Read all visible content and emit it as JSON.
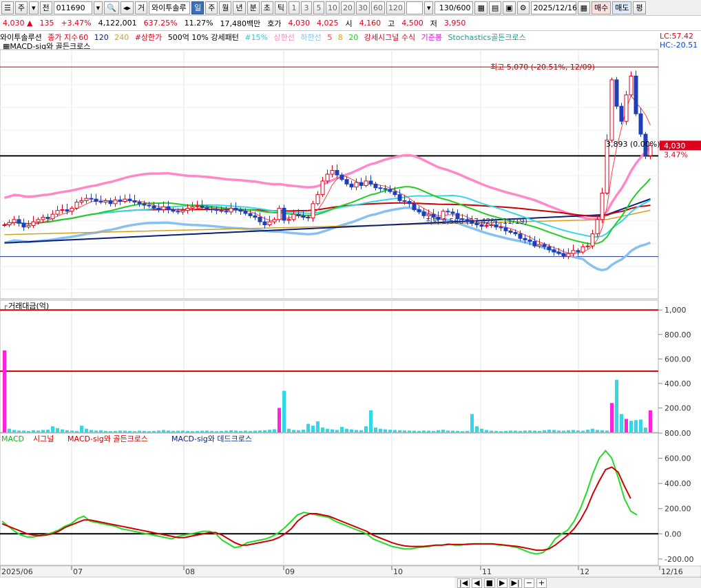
{
  "toolbar": {
    "market_label": "주",
    "jeon_label": "전",
    "code": "011690",
    "geo_label": "거",
    "stock_name": "와이투솔루",
    "periods": [
      "일",
      "주",
      "월",
      "년",
      "분",
      "초",
      "틱"
    ],
    "selected_period": "일",
    "numbers": [
      "1",
      "3",
      "5",
      "10",
      "20",
      "30",
      "60",
      "120"
    ],
    "count": "130/600",
    "date": "2025/12/16",
    "buy_label": "매수",
    "sell_label": "매도",
    "flat_label": "평"
  },
  "quote": {
    "price": "4,030",
    "change": "135",
    "change_pct": "+3.47%",
    "volume": "4,122,001",
    "vol_ratio": "637.25%",
    "turnover": "11.27%",
    "amount": "17,480백만",
    "hoga_label": "호가",
    "hoga1": "4,030",
    "hoga2": "4,025",
    "open_label": "시",
    "open": "4,160",
    "high_label": "고",
    "high": "4,500",
    "low_label": "저",
    "low": "3,950"
  },
  "legend": {
    "name": "와이투솔루션",
    "ma_label": "종가 지수",
    "ma60": "60",
    "ma120": "120",
    "ma240": "240",
    "upper_limit": "#상한가",
    "pattern": "500억 10% 강세패턴",
    "pct15": "#15%",
    "upper_line": "상한선",
    "lower_line": "하한선",
    "ma5": "5",
    "ma8": "8",
    "ma20": "20",
    "strong_signal": "강세시그널 수식",
    "base_line": "기준봉",
    "stoch": "Stochastics골든크로스",
    "macd_gold": "MACD-sig와 골든크로스",
    "lc": "LC:57.42",
    "hc": "HC:-20.51"
  },
  "price_panel": {
    "max_label": "최고 5,070 (-20.51%, 12/09)",
    "min_label": "최저 2,560 (57.42%, 11/19)",
    "line_label": "3,893 (0.00%)",
    "current_price": "4,030",
    "current_pct": "3.47%"
  },
  "volume_panel": {
    "title": "거래대금(억)",
    "ticks": [
      "1,000",
      "800.00",
      "600.00",
      "400.00",
      "200.00"
    ]
  },
  "macd_panel": {
    "title_macd": "MACD",
    "title_signal": "시그널",
    "title_gold": "MACD-sig와 골든크로스",
    "title_dead": "MACD-sig와 데드크로스",
    "ticks": [
      "800.00",
      "600.00",
      "400.00",
      "200.00",
      "0.00",
      "-200.00"
    ]
  },
  "x_axis": {
    "labels": [
      "2025/06",
      "07",
      "08",
      "09",
      "10",
      "11",
      "12",
      "12/16"
    ]
  },
  "colors": {
    "up": "#e0001b",
    "down": "#1f3fb8",
    "ma5": "#ff4040",
    "ma20": "#22cc22",
    "envelope": "#ff88c8",
    "bb_lower": "#88c0f0",
    "ma60": "#cc0000",
    "ma120": "#0a1f7a",
    "ma240": "#d4a020",
    "cyan": "#33d8e8",
    "magenta": "#ff22dd",
    "macd": "#22dd22",
    "signal": "#cc0000"
  },
  "chart_data": [
    {
      "type": "candlestick",
      "title": "와이투솔루션",
      "y_range": [
        2000,
        5300
      ],
      "y_labels": [],
      "notable": {
        "high": 5070,
        "high_date": "12/09",
        "low": 2560,
        "low_date": "11/19",
        "horizontal_line": 3893,
        "last": 4030
      },
      "closes": [
        2980,
        3010,
        3050,
        3000,
        2950,
        2970,
        3020,
        3050,
        3080,
        3060,
        3120,
        3170,
        3180,
        3160,
        3200,
        3280,
        3300,
        3330,
        3320,
        3290,
        3280,
        3300,
        3260,
        3310,
        3290,
        3320,
        3300,
        3280,
        3260,
        3240,
        3230,
        3200,
        3180,
        3220,
        3180,
        3160,
        3150,
        3170,
        3200,
        3220,
        3230,
        3210,
        3190,
        3180,
        3170,
        3160,
        3150,
        3200,
        3180,
        3160,
        3130,
        3100,
        3080,
        3020,
        2980,
        3020,
        3050,
        3200,
        3040,
        3050,
        3120,
        3100,
        3080,
        3070,
        3260,
        3380,
        3560,
        3650,
        3700,
        3640,
        3580,
        3520,
        3480,
        3540,
        3500,
        3560,
        3520,
        3470,
        3460,
        3450,
        3420,
        3380,
        3300,
        3290,
        3260,
        3180,
        3150,
        3100,
        3120,
        3080,
        3050,
        3160,
        3150,
        3130,
        3060,
        3050,
        3020,
        3000,
        2980,
        2960,
        2970,
        2980,
        2950,
        2940,
        2900,
        2880,
        2860,
        2800,
        2780,
        2760,
        2700,
        2720,
        2690,
        2650,
        2620,
        2600,
        2560,
        2600,
        2640,
        2620,
        2690,
        2700,
        2860,
        3050,
        3400,
        4100,
        4900,
        4550,
        4350,
        4700,
        4950,
        4450,
        4180,
        3895,
        4030
      ]
    },
    {
      "type": "bar",
      "title": "거래대금(억)",
      "ylim": [
        0,
        1080
      ],
      "reference_lines": [
        1000,
        500
      ],
      "values": [
        670,
        30,
        20,
        15,
        15,
        12,
        18,
        15,
        20,
        22,
        50,
        35,
        25,
        18,
        15,
        12,
        55,
        30,
        20,
        15,
        18,
        12,
        10,
        12,
        15,
        14,
        12,
        10,
        14,
        12,
        10,
        12,
        15,
        20,
        15,
        12,
        14,
        15,
        12,
        10,
        12,
        14,
        15,
        12,
        10,
        12,
        14,
        18,
        15,
        12,
        15,
        12,
        14,
        16,
        18,
        22,
        26,
        200,
        340,
        30,
        20,
        18,
        22,
        70,
        55,
        90,
        40,
        30,
        25,
        20,
        45,
        30,
        25,
        20,
        18,
        50,
        180,
        40,
        30,
        25,
        22,
        20,
        18,
        16,
        15,
        14,
        12,
        15,
        14,
        12,
        18,
        22,
        15,
        14,
        12,
        10,
        12,
        150,
        50,
        30,
        20,
        14,
        12,
        10,
        12,
        15,
        14,
        12,
        15,
        16,
        14,
        12,
        18,
        22,
        20,
        15,
        14,
        18,
        20,
        16,
        14,
        22,
        30,
        20,
        18,
        15,
        240,
        430,
        150,
        110,
        95,
        100,
        105,
        40,
        180
      ]
    },
    {
      "type": "line",
      "title": "MACD",
      "ylim": [
        -250,
        800
      ],
      "y_ticks": [
        800,
        600,
        400,
        200,
        0,
        -200
      ],
      "series": [
        {
          "name": "MACD",
          "values": [
            100,
            60,
            20,
            -10,
            -25,
            -25,
            -15,
            -5,
            10,
            30,
            60,
            80,
            120,
            140,
            100,
            90,
            80,
            70,
            60,
            40,
            30,
            20,
            10,
            0,
            -10,
            -20,
            -30,
            -40,
            -20,
            -10,
            0,
            10,
            20,
            20,
            0,
            -50,
            -80,
            -110,
            -100,
            -70,
            -60,
            -50,
            -40,
            -20,
            10,
            50,
            100,
            150,
            170,
            160,
            150,
            140,
            130,
            100,
            80,
            60,
            40,
            20,
            0,
            -40,
            -60,
            -80,
            -100,
            -110,
            -120,
            -120,
            -110,
            -105,
            -100,
            -90,
            -90,
            -80,
            -90,
            -90,
            -80,
            -80,
            -80,
            -80,
            -80,
            -90,
            -90,
            -100,
            -110,
            -130,
            -150,
            -160,
            -150,
            -110,
            -40,
            0,
            30,
            100,
            200,
            330,
            480,
            600,
            660,
            600,
            450,
            280,
            180,
            150
          ]
        },
        {
          "name": "시그널",
          "values": [
            80,
            60,
            40,
            20,
            0,
            -10,
            -15,
            -10,
            0,
            20,
            50,
            70,
            90,
            110,
            110,
            100,
            90,
            80,
            70,
            60,
            50,
            40,
            30,
            20,
            10,
            0,
            -10,
            -20,
            -30,
            -30,
            -20,
            -10,
            0,
            10,
            10,
            -10,
            -40,
            -70,
            -90,
            -90,
            -80,
            -70,
            -60,
            -50,
            -30,
            0,
            40,
            100,
            140,
            160,
            160,
            150,
            140,
            120,
            100,
            80,
            60,
            40,
            20,
            -10,
            -30,
            -50,
            -70,
            -85,
            -95,
            -100,
            -100,
            -100,
            -95,
            -90,
            -90,
            -85,
            -85,
            -85,
            -85,
            -80,
            -80,
            -80,
            -80,
            -85,
            -90,
            -95,
            -100,
            -110,
            -120,
            -130,
            -130,
            -120,
            -90,
            -50,
            -10,
            40,
            110,
            200,
            320,
            420,
            510,
            530,
            490,
            380,
            280
          ]
        }
      ]
    }
  ]
}
